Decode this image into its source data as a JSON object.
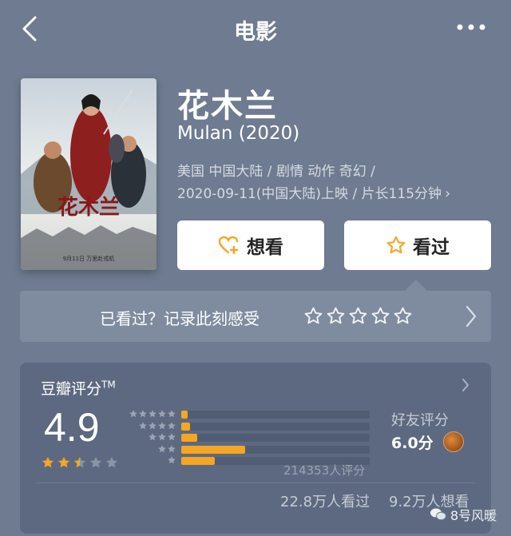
{
  "nav": {
    "title": "电影"
  },
  "movie": {
    "title": "花木兰",
    "subtitle": "Mulan (2020)",
    "meta_line1": "美国 中国大陆 / 剧情 动作 奇幻 /",
    "meta_line2": "2020-09-11(中国大陆)上映 / 片长115分钟",
    "poster_title": "花木兰",
    "poster_date": "9月11日  万里赴戎机"
  },
  "actions": {
    "want_label": "想看",
    "seen_label": "看过"
  },
  "record": {
    "label": "已看过？记录此刻感受",
    "star_count": 5
  },
  "rating": {
    "title": "豆瓣评分",
    "tm": "TM",
    "score": "4.9",
    "stars_value": 2.5,
    "distribution": [
      {
        "stars": 5,
        "fraction": 0.035
      },
      {
        "stars": 4,
        "fraction": 0.045
      },
      {
        "stars": 3,
        "fraction": 0.085
      },
      {
        "stars": 2,
        "fraction": 0.34
      },
      {
        "stars": 1,
        "fraction": 0.18
      }
    ],
    "count_text": "214353人评分",
    "friends_label": "好友评分",
    "friends_score": "6.0分",
    "watched_text": "22.8万人看过",
    "wish_text": "9.2万人想看"
  },
  "watermark": {
    "text": "8号风暖"
  },
  "colors": {
    "background": "#6e7b90",
    "accent": "#f5a623",
    "card": "#5d6980"
  }
}
